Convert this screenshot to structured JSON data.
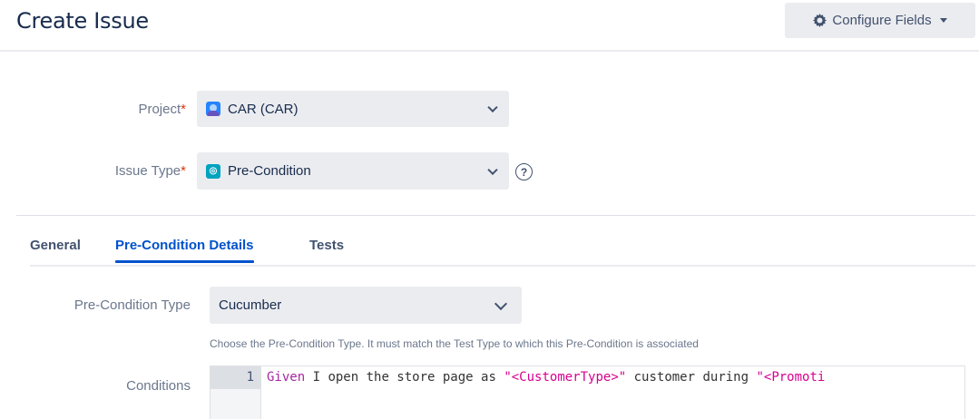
{
  "header": {
    "title": "Create Issue",
    "configure_label": "Configure Fields"
  },
  "form": {
    "project": {
      "label": "Project",
      "required_mark": "*",
      "value": "CAR (CAR)"
    },
    "issue_type": {
      "label": "Issue Type",
      "required_mark": "*",
      "value": "Pre-Condition",
      "help": "?"
    }
  },
  "tabs": [
    {
      "label": "General",
      "active": false
    },
    {
      "label": "Pre-Condition Details",
      "active": true
    },
    {
      "label": "Tests",
      "active": false
    }
  ],
  "details": {
    "type_label": "Pre-Condition Type",
    "type_value": "Cucumber",
    "type_hint": "Choose the Pre-Condition Type. It must match the Test Type to which this Pre-Condition is associated",
    "conditions_label": "Conditions",
    "editor": {
      "line_number": "1",
      "code_keyword": "Given",
      "code_text_1": " I open the store page as ",
      "code_string_1": "\"<CustomerType>\"",
      "code_text_2": " customer during ",
      "code_string_2": "\"<Promoti"
    }
  },
  "colors": {
    "accent": "#0052cc",
    "required": "#de350b",
    "button_bg": "#ebecf0"
  }
}
